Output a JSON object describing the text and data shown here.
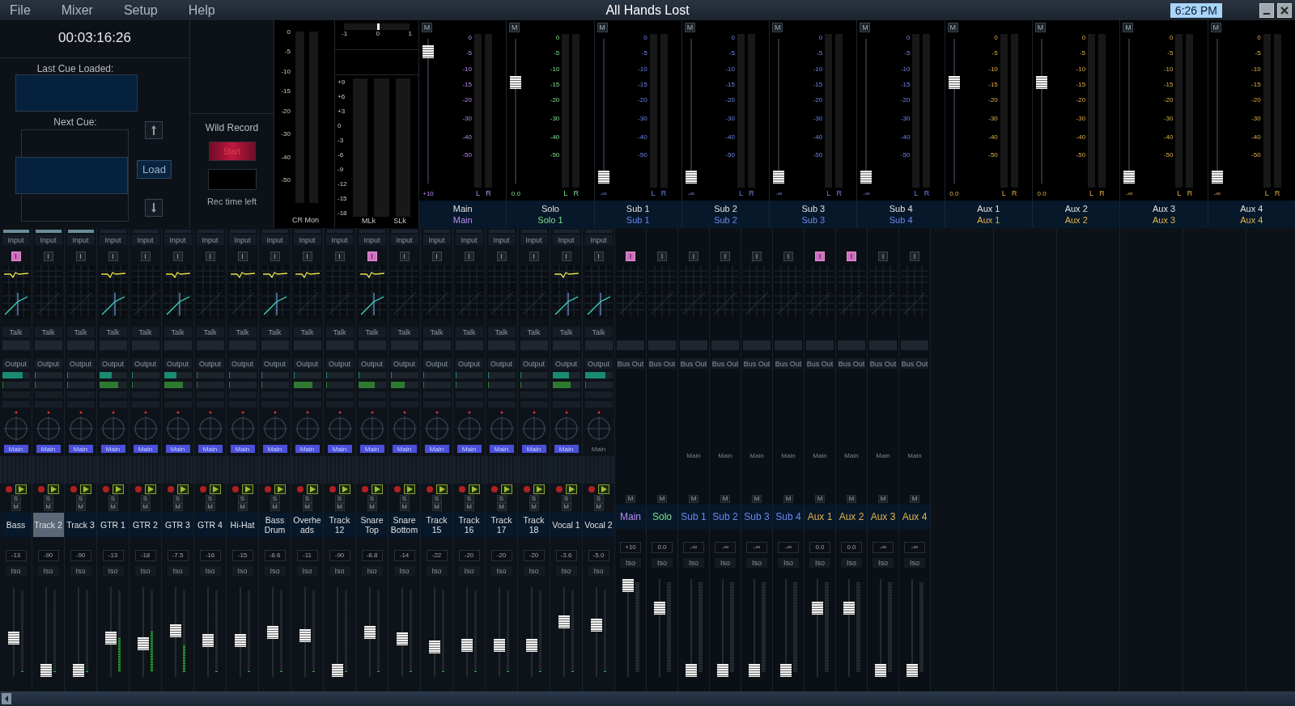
{
  "menu": {
    "items": [
      "File",
      "Mixer",
      "Setup",
      "Help"
    ],
    "title": "All Hands Lost",
    "clock": "6:26 PM"
  },
  "transport": {
    "timecode": "00:03:16:26",
    "last_cue_label": "Last Cue Loaded:",
    "next_cue_label": "Next Cue:",
    "load_button": "Load"
  },
  "wild_record": {
    "title": "Wild Record",
    "start_button": "Start",
    "rec_time_label": "Rec time left"
  },
  "cr_meter": {
    "scale": [
      "0",
      "-5",
      "-10",
      "-15",
      "-20",
      "-30",
      "-40",
      "-50"
    ],
    "label": "CR Mon"
  },
  "phase_meter": {
    "ticks": [
      "-1",
      "0",
      "1"
    ],
    "scale": [
      "+9",
      "+6",
      "+3",
      "0",
      "-3",
      "-6",
      "-9",
      "-12",
      "-15",
      "-18"
    ],
    "labels": [
      "MLk",
      "SLk"
    ]
  },
  "bus_meters": [
    {
      "mute": "M",
      "name": "Main",
      "subname": "Main",
      "color": "#b98cf0",
      "scale": [
        "0",
        "-5",
        "-10",
        "-15",
        "-20",
        "-30",
        "-40",
        "-50"
      ],
      "sides": [
        "L",
        "R"
      ],
      "fader": {
        "level": 0.95
      },
      "fader_reading": "+10"
    },
    {
      "mute": "M",
      "name": "Solo",
      "subname": "Solo 1",
      "color": "#7ee08a",
      "scale": [
        "0",
        "-5",
        "-10",
        "-15",
        "-20",
        "-30",
        "-40",
        "-50"
      ],
      "sides": [
        "L",
        "R"
      ],
      "fader": {
        "level": 0.72
      },
      "fader_reading": "0.0"
    },
    {
      "mute": "M",
      "name": "Sub 1",
      "subname": "Sub 1",
      "color": "#6f86f0",
      "scale": [
        "0",
        "-5",
        "-10",
        "-15",
        "-20",
        "-30",
        "-40",
        "-50"
      ],
      "sides": [
        "L",
        "R"
      ],
      "fader": {
        "level": 0
      },
      "fader_reading": "-∞"
    },
    {
      "mute": "M",
      "name": "Sub 2",
      "subname": "Sub 2",
      "color": "#6f86f0",
      "scale": [
        "0",
        "-5",
        "-10",
        "-15",
        "-20",
        "-30",
        "-40",
        "-50"
      ],
      "sides": [
        "L",
        "R"
      ],
      "fader": {
        "level": 0
      },
      "fader_reading": "-∞"
    },
    {
      "mute": "M",
      "name": "Sub 3",
      "subname": "Sub 3",
      "color": "#6f86f0",
      "scale": [
        "0",
        "-5",
        "-10",
        "-15",
        "-20",
        "-30",
        "-40",
        "-50"
      ],
      "sides": [
        "L",
        "R"
      ],
      "fader": {
        "level": 0
      },
      "fader_reading": "-∞"
    },
    {
      "mute": "M",
      "name": "Sub 4",
      "subname": "Sub 4",
      "color": "#6f86f0",
      "scale": [
        "0",
        "-5",
        "-10",
        "-15",
        "-20",
        "-30",
        "-40",
        "-50"
      ],
      "sides": [
        "L",
        "R"
      ],
      "fader": {
        "level": 0
      },
      "fader_reading": "-∞"
    },
    {
      "mute": "M",
      "name": "Aux 1",
      "subname": "Aux 1",
      "color": "#e0b048",
      "scale": [
        "0",
        "-5",
        "-10",
        "-15",
        "-20",
        "-30",
        "-40",
        "-50"
      ],
      "sides": [
        "L",
        "R"
      ],
      "fader": {
        "level": 0.72
      },
      "fader_reading": "0.0"
    },
    {
      "mute": "M",
      "name": "Aux 2",
      "subname": "Aux 2",
      "color": "#e0b048",
      "scale": [
        "0",
        "-5",
        "-10",
        "-15",
        "-20",
        "-30",
        "-40",
        "-50"
      ],
      "sides": [
        "L",
        "R"
      ],
      "fader": {
        "level": 0.72
      },
      "fader_reading": "0.0"
    },
    {
      "mute": "M",
      "name": "Aux 3",
      "subname": "Aux 3",
      "color": "#e0b048",
      "scale": [
        "0",
        "-5",
        "-10",
        "-15",
        "-20",
        "-30",
        "-40",
        "-50"
      ],
      "sides": [
        "L",
        "R"
      ],
      "fader": {
        "level": 0
      },
      "fader_reading": "-∞"
    },
    {
      "mute": "M",
      "name": "Aux 4",
      "subname": "Aux 4",
      "color": "#e0b048",
      "scale": [
        "0",
        "-5",
        "-10",
        "-15",
        "-20",
        "-30",
        "-40",
        "-50"
      ],
      "sides": [
        "L",
        "R"
      ],
      "fader": {
        "level": 0
      },
      "fader_reading": "-∞"
    }
  ],
  "channels": [
    {
      "name": "Bass",
      "selected": false,
      "top_bar": true,
      "input": "Input",
      "insert": "I",
      "insert_on": true,
      "eq_on": true,
      "dyn_on": true,
      "talk": "Talk",
      "output": "Output",
      "sends": [
        {
          "level": 0.75
        },
        {
          "level": 0
        }
      ],
      "route": "Main",
      "route_on": true,
      "solo": "S",
      "mute": "M",
      "reading": "-13",
      "iso": "Iso",
      "fader": {
        "level": 0.42
      },
      "meter": {
        "level": 0
      }
    },
    {
      "name": "Track 2",
      "selected": true,
      "top_bar": true,
      "input": "Input",
      "insert": "I",
      "insert_on": false,
      "eq_on": false,
      "dyn_on": false,
      "talk": "Talk",
      "output": "Output",
      "sends": [
        {
          "level": 0
        },
        {
          "level": 0
        }
      ],
      "route": "Main",
      "route_on": true,
      "solo": "S",
      "mute": "M",
      "reading": "-90",
      "iso": "Iso",
      "fader": {
        "level": 0
      },
      "meter": {
        "level": 0
      }
    },
    {
      "name": "Track 3",
      "selected": false,
      "top_bar": true,
      "input": "Input",
      "insert": "I",
      "insert_on": false,
      "eq_on": false,
      "dyn_on": false,
      "talk": "Talk",
      "output": "Output",
      "sends": [
        {
          "level": 0
        },
        {
          "level": 0
        }
      ],
      "route": "Main",
      "route_on": true,
      "solo": "S",
      "mute": "M",
      "reading": "-90",
      "iso": "Iso",
      "fader": {
        "level": 0
      },
      "meter": {
        "level": 0
      }
    },
    {
      "name": "GTR 1",
      "selected": false,
      "top_bar": false,
      "input": "Input",
      "insert": "I",
      "insert_on": false,
      "eq_on": true,
      "dyn_on": true,
      "talk": "Talk",
      "output": "Output",
      "sends": [
        {
          "level": 0.45
        },
        {
          "level": 0.7
        }
      ],
      "route": "Main",
      "route_on": true,
      "solo": "S",
      "mute": "M",
      "reading": "-13",
      "iso": "Iso",
      "fader": {
        "level": 0.42
      },
      "meter": {
        "level": 0.42
      }
    },
    {
      "name": "GTR 2",
      "selected": false,
      "top_bar": false,
      "input": "Input",
      "insert": "I",
      "insert_on": false,
      "eq_on": false,
      "dyn_on": false,
      "talk": "Talk",
      "output": "Output",
      "sends": [
        {
          "level": 0
        },
        {
          "level": 0
        }
      ],
      "route": "Main",
      "route_on": true,
      "solo": "S",
      "mute": "M",
      "reading": "-18",
      "iso": "Iso",
      "fader": {
        "level": 0.35
      },
      "meter": {
        "level": 0.5
      }
    },
    {
      "name": "GTR 3",
      "selected": false,
      "top_bar": false,
      "input": "Input",
      "insert": "I",
      "insert_on": false,
      "eq_on": true,
      "dyn_on": true,
      "talk": "Talk",
      "output": "Output",
      "sends": [
        {
          "level": 0.45
        },
        {
          "level": 0.7
        }
      ],
      "route": "Main",
      "route_on": true,
      "solo": "S",
      "mute": "M",
      "reading": "-7.5",
      "iso": "Iso",
      "fader": {
        "level": 0.52
      },
      "meter": {
        "level": 0.33
      }
    },
    {
      "name": "GTR 4",
      "selected": false,
      "top_bar": false,
      "input": "Input",
      "insert": "I",
      "insert_on": false,
      "eq_on": false,
      "dyn_on": false,
      "talk": "Talk",
      "output": "Output",
      "sends": [
        {
          "level": 0
        },
        {
          "level": 0
        }
      ],
      "route": "Main",
      "route_on": true,
      "solo": "S",
      "mute": "M",
      "reading": "-16",
      "iso": "Iso",
      "fader": {
        "level": 0.39
      },
      "meter": {
        "level": 0
      }
    },
    {
      "name": "Hi-Hat",
      "selected": false,
      "top_bar": false,
      "input": "Input",
      "insert": "I",
      "insert_on": false,
      "eq_on": true,
      "dyn_on": false,
      "talk": "Talk",
      "output": "Output",
      "sends": [
        {
          "level": 0
        },
        {
          "level": 0
        }
      ],
      "route": "Main",
      "route_on": true,
      "solo": "S",
      "mute": "M",
      "reading": "-15",
      "iso": "Iso",
      "fader": {
        "level": 0.39
      },
      "meter": {
        "level": 0
      }
    },
    {
      "name": "Bass Drum",
      "selected": false,
      "top_bar": false,
      "input": "Input",
      "insert": "I",
      "insert_on": false,
      "eq_on": true,
      "dyn_on": true,
      "talk": "Talk",
      "output": "Output",
      "sends": [
        {
          "level": 0
        },
        {
          "level": 0
        }
      ],
      "route": "Main",
      "route_on": true,
      "solo": "S",
      "mute": "M",
      "reading": "-8.6",
      "iso": "Iso",
      "fader": {
        "level": 0.5
      },
      "meter": {
        "level": 0
      }
    },
    {
      "name": "Overheads",
      "selected": false,
      "top_bar": false,
      "input": "Input",
      "insert": "I",
      "insert_on": false,
      "eq_on": true,
      "dyn_on": false,
      "talk": "Talk",
      "output": "Output",
      "sends": [
        {
          "level": 0
        },
        {
          "level": 0.7
        }
      ],
      "route": "Main",
      "route_on": true,
      "solo": "S",
      "mute": "M",
      "reading": "-11",
      "iso": "Iso",
      "fader": {
        "level": 0.45
      },
      "meter": {
        "level": 0
      }
    },
    {
      "name": "Track 12",
      "selected": false,
      "top_bar": false,
      "input": "Input",
      "insert": "I",
      "insert_on": false,
      "eq_on": false,
      "dyn_on": false,
      "talk": "Talk",
      "output": "Output",
      "sends": [
        {
          "level": 0
        },
        {
          "level": 0
        }
      ],
      "route": "Main",
      "route_on": true,
      "solo": "S",
      "mute": "M",
      "reading": "-90",
      "iso": "Iso",
      "fader": {
        "level": 0
      },
      "meter": {
        "level": 0
      }
    },
    {
      "name": "Snare Top",
      "selected": false,
      "top_bar": false,
      "input": "Input",
      "insert": "I",
      "insert_on": true,
      "eq_on": true,
      "dyn_on": true,
      "talk": "Talk",
      "output": "Output",
      "sends": [
        {
          "level": 0
        },
        {
          "level": 0.6
        }
      ],
      "route": "Main",
      "route_on": true,
      "solo": "S",
      "mute": "M",
      "reading": "-8.8",
      "iso": "Iso",
      "fader": {
        "level": 0.49
      },
      "meter": {
        "level": 0
      }
    },
    {
      "name": "Snare Bottom",
      "selected": false,
      "top_bar": false,
      "input": "Input",
      "insert": "I",
      "insert_on": false,
      "eq_on": false,
      "dyn_on": false,
      "talk": "Talk",
      "output": "Output",
      "sends": [
        {
          "level": 0
        },
        {
          "level": 0.5
        }
      ],
      "route": "Main",
      "route_on": true,
      "solo": "S",
      "mute": "M",
      "reading": "-14",
      "iso": "Iso",
      "fader": {
        "level": 0.41
      },
      "meter": {
        "level": 0
      }
    },
    {
      "name": "Track 15",
      "selected": false,
      "top_bar": false,
      "input": "Input",
      "insert": "I",
      "insert_on": false,
      "eq_on": false,
      "dyn_on": false,
      "talk": "Talk",
      "output": "Output",
      "sends": [
        {
          "level": 0
        },
        {
          "level": 0
        }
      ],
      "route": "Main",
      "route_on": true,
      "solo": "S",
      "mute": "M",
      "reading": "-22",
      "iso": "Iso",
      "fader": {
        "level": 0.31
      },
      "meter": {
        "level": 0
      }
    },
    {
      "name": "Track 16",
      "selected": false,
      "top_bar": false,
      "input": "Input",
      "insert": "I",
      "insert_on": false,
      "eq_on": false,
      "dyn_on": false,
      "talk": "Talk",
      "output": "Output",
      "sends": [
        {
          "level": 0
        },
        {
          "level": 0
        }
      ],
      "route": "Main",
      "route_on": true,
      "solo": "S",
      "mute": "M",
      "reading": "-20",
      "iso": "Iso",
      "fader": {
        "level": 0.33
      },
      "meter": {
        "level": 0
      }
    },
    {
      "name": "Track 17",
      "selected": false,
      "top_bar": false,
      "input": "Input",
      "insert": "I",
      "insert_on": false,
      "eq_on": false,
      "dyn_on": false,
      "talk": "Talk",
      "output": "Output",
      "sends": [
        {
          "level": 0
        },
        {
          "level": 0
        }
      ],
      "route": "Main",
      "route_on": true,
      "solo": "S",
      "mute": "M",
      "reading": "-20",
      "iso": "Iso",
      "fader": {
        "level": 0.33
      },
      "meter": {
        "level": 0
      }
    },
    {
      "name": "Track 18",
      "selected": false,
      "top_bar": false,
      "input": "Input",
      "insert": "I",
      "insert_on": false,
      "eq_on": false,
      "dyn_on": false,
      "talk": "Talk",
      "output": "Output",
      "sends": [
        {
          "level": 0
        },
        {
          "level": 0
        }
      ],
      "route": "Main",
      "route_on": true,
      "solo": "S",
      "mute": "M",
      "reading": "-20",
      "iso": "Iso",
      "fader": {
        "level": 0.33
      },
      "meter": {
        "level": 0
      }
    },
    {
      "name": "Vocal 1",
      "selected": false,
      "top_bar": false,
      "input": "Input",
      "insert": "I",
      "insert_on": false,
      "eq_on": true,
      "dyn_on": true,
      "talk": "Talk",
      "output": "Output",
      "sends": [
        {
          "level": 0.6
        },
        {
          "level": 0.65
        }
      ],
      "route": "Main",
      "route_on": true,
      "solo": "S",
      "mute": "M",
      "reading": "-3.6",
      "iso": "Iso",
      "fader": {
        "level": 0.63
      },
      "meter": {
        "level": 0
      }
    },
    {
      "name": "Vocal 2",
      "selected": false,
      "top_bar": false,
      "input": "Input",
      "insert": "I",
      "insert_on": false,
      "eq_on": false,
      "dyn_on": true,
      "talk": "Talk",
      "output": "Output",
      "sends": [
        {
          "level": 0.75
        },
        {
          "level": 0
        }
      ],
      "route": "Main",
      "route_on": false,
      "solo": "S",
      "mute": "M",
      "reading": "-5.0",
      "iso": "Iso",
      "fader": {
        "level": 0.59
      },
      "meter": {
        "level": 0
      }
    }
  ],
  "buses": [
    {
      "name": "Main",
      "color": "#b98cf0",
      "insert": "I",
      "insert_on": true,
      "output": "Bus Out",
      "mute": "M",
      "reading": "+10",
      "iso": "Iso",
      "fader": {
        "level": 1
      }
    },
    {
      "name": "Solo",
      "color": "#7ee08a",
      "insert": "I",
      "insert_on": false,
      "output": "Bus Out",
      "mute": "M",
      "reading": "0.0",
      "iso": "Iso",
      "fader": {
        "level": 0.73
      }
    },
    {
      "name": "Sub 1",
      "color": "#6f86f0",
      "insert": "I",
      "insert_on": false,
      "output": "Bus Out",
      "route": "Main",
      "mute": "M",
      "reading": "-∞",
      "iso": "Iso",
      "fader": {
        "level": 0
      }
    },
    {
      "name": "Sub 2",
      "color": "#6f86f0",
      "insert": "I",
      "insert_on": false,
      "output": "Bus Out",
      "route": "Main",
      "mute": "M",
      "reading": "-∞",
      "iso": "Iso",
      "fader": {
        "level": 0
      }
    },
    {
      "name": "Sub 3",
      "color": "#6f86f0",
      "insert": "I",
      "insert_on": false,
      "output": "Bus Out",
      "route": "Main",
      "mute": "M",
      "reading": "-∞",
      "iso": "Iso",
      "fader": {
        "level": 0
      }
    },
    {
      "name": "Sub 4",
      "color": "#6f86f0",
      "insert": "I",
      "insert_on": false,
      "output": "Bus Out",
      "route": "Main",
      "mute": "M",
      "reading": "-∞",
      "iso": "Iso",
      "fader": {
        "level": 0
      }
    },
    {
      "name": "Aux 1",
      "color": "#e0b048",
      "insert": "I",
      "insert_on": true,
      "output": "Bus Out",
      "route": "Main",
      "mute": "M",
      "reading": "0.0",
      "iso": "Iso",
      "fader": {
        "level": 0.73
      }
    },
    {
      "name": "Aux 2",
      "color": "#e0b048",
      "insert": "I",
      "insert_on": true,
      "output": "Bus Out",
      "route": "Main",
      "mute": "M",
      "reading": "0.0",
      "iso": "Iso",
      "fader": {
        "level": 0.73
      }
    },
    {
      "name": "Aux 3",
      "color": "#e0b048",
      "insert": "I",
      "insert_on": false,
      "output": "Bus Out",
      "route": "Main",
      "mute": "M",
      "reading": "-∞",
      "iso": "Iso",
      "fader": {
        "level": 0
      }
    },
    {
      "name": "Aux 4",
      "color": "#e0b048",
      "insert": "I",
      "insert_on": false,
      "output": "Bus Out",
      "route": "Main",
      "mute": "M",
      "reading": "-∞",
      "iso": "Iso",
      "fader": {
        "level": 0
      }
    }
  ]
}
